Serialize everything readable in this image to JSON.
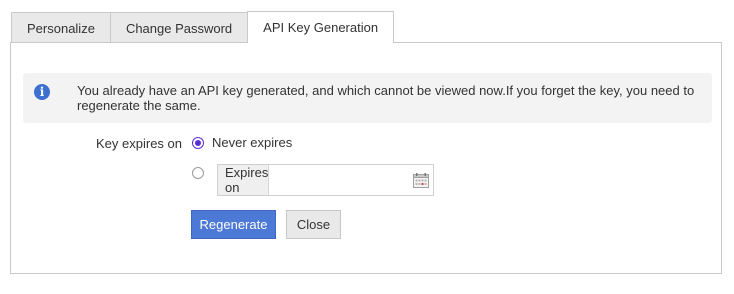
{
  "tabs": [
    {
      "label": "Personalize",
      "active": false
    },
    {
      "label": "Change Password",
      "active": false
    },
    {
      "label": "API Key Generation",
      "active": true
    }
  ],
  "info": {
    "icon": "info-icon",
    "message": "You already have an API key generated, and which cannot be viewed now.If you forget the key, you need to regenerate the same."
  },
  "expiry": {
    "label": "Key expires on",
    "options": [
      {
        "label": "Never expires",
        "selected": true
      },
      {
        "label": "",
        "selected": false
      }
    ],
    "date_addon_label": "Expires on",
    "date_value": ""
  },
  "buttons": {
    "regenerate": "Regenerate",
    "close": "Close"
  },
  "colors": {
    "primary": "#4c78d6",
    "radio_selected": "#5b2fd6",
    "info_icon": "#3d6fd1"
  }
}
